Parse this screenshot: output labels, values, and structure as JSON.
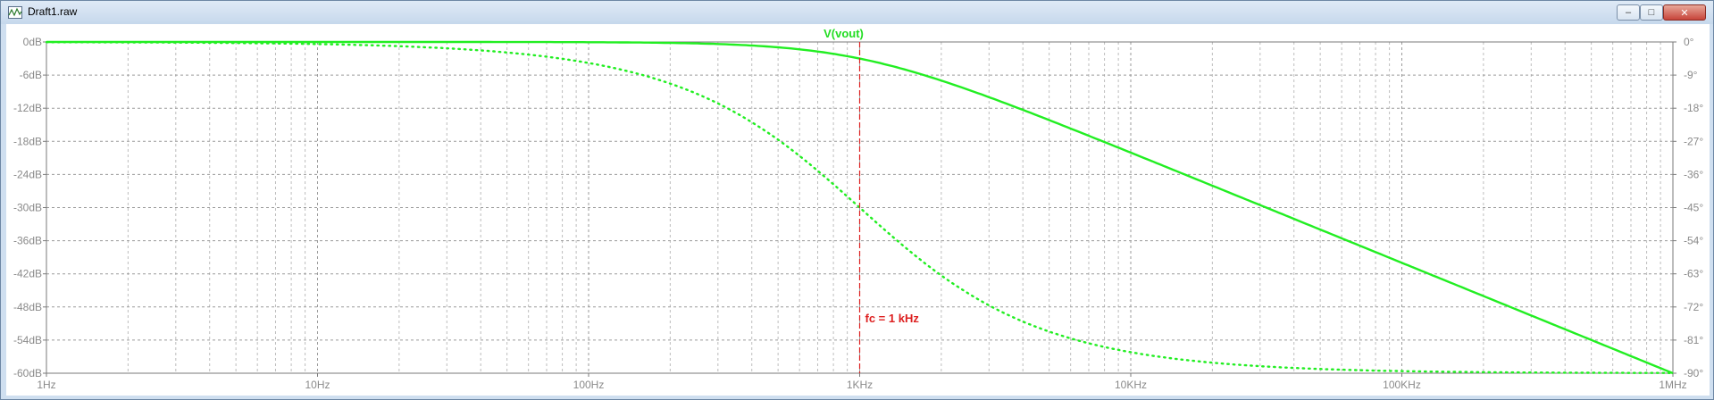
{
  "window": {
    "title": "Draft1.raw",
    "buttons": {
      "minimize": "–",
      "maximize": "□",
      "close": "✕"
    }
  },
  "colors": {
    "trace": "#22ee22",
    "cursor": "#dd2020",
    "grid_major": "#9a9a9a",
    "grid_minor": "#bdbdbd"
  },
  "chart_data": {
    "type": "line",
    "trace_name": "V(vout)",
    "x_scale": "log",
    "x_range_hz": [
      1,
      1000000
    ],
    "x_tick_values": [
      1,
      10,
      100,
      1000,
      10000,
      100000,
      1000000
    ],
    "x_tick_labels": [
      "1Hz",
      "10Hz",
      "100Hz",
      "1KHz",
      "10KHz",
      "100KHz",
      "1MHz"
    ],
    "y_left_range_db": [
      -60,
      0
    ],
    "y_left_tick_labels": [
      "0dB",
      "-6dB",
      "-12dB",
      "-18dB",
      "-24dB",
      "-30dB",
      "-36dB",
      "-42dB",
      "-48dB",
      "-54dB",
      "-60dB"
    ],
    "y_right_range_deg": [
      -90,
      0
    ],
    "y_right_tick_labels": [
      "0°",
      "-9°",
      "-18°",
      "-27°",
      "-36°",
      "-45°",
      "-54°",
      "-63°",
      "-72°",
      "-81°",
      "-90°"
    ],
    "grid": true,
    "cutoff_hz": 1000,
    "annotation": "fc = 1 kHz",
    "series": [
      {
        "quantity": "magnitude (dB)",
        "style": "solid",
        "model": "first-order low-pass"
      },
      {
        "quantity": "phase (deg)",
        "style": "dotted",
        "model": "first-order low-pass"
      }
    ]
  }
}
